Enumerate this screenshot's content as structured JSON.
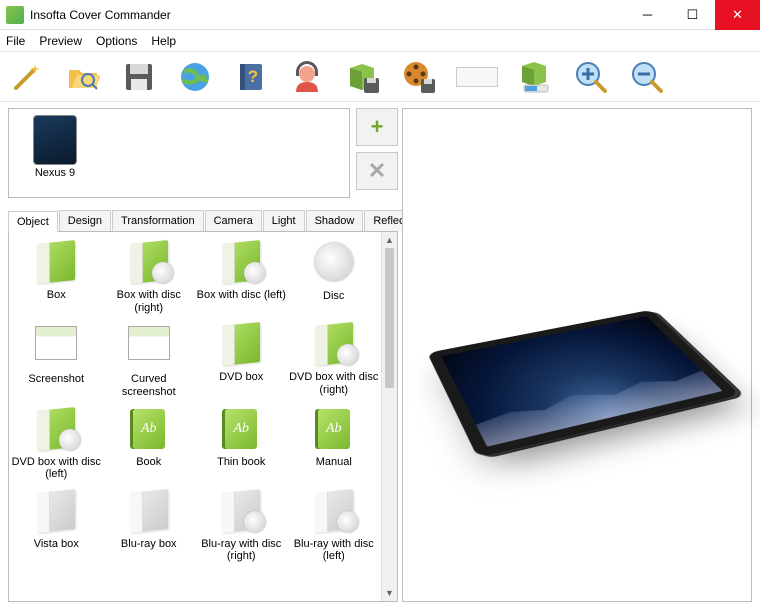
{
  "app": {
    "title": "Insofta Cover Commander"
  },
  "menu": [
    "File",
    "Preview",
    "Options",
    "Help"
  ],
  "toolbar_icons": [
    "wand",
    "open",
    "save",
    "globe",
    "help-book",
    "support",
    "save-pkg",
    "film-save",
    "input",
    "save-progress",
    "zoom-in",
    "zoom-out"
  ],
  "object_panel": {
    "selected_name": "Nexus 9",
    "add_label": "+",
    "del_label": "✕"
  },
  "tabs": [
    "Object",
    "Design",
    "Transformation",
    "Camera",
    "Light",
    "Shadow",
    "Reflection"
  ],
  "active_tab": 0,
  "gallery": [
    {
      "label": "Box",
      "kind": "box"
    },
    {
      "label": "Box with disc (right)",
      "kind": "box-disc"
    },
    {
      "label": "Box with disc (left)",
      "kind": "box-disc"
    },
    {
      "label": "Disc",
      "kind": "disc"
    },
    {
      "label": "Screenshot",
      "kind": "screenshot"
    },
    {
      "label": "Curved screenshot",
      "kind": "screenshot"
    },
    {
      "label": "DVD box",
      "kind": "box"
    },
    {
      "label": "DVD box with disc (right)",
      "kind": "box-disc"
    },
    {
      "label": "DVD box with disc (left)",
      "kind": "box-disc"
    },
    {
      "label": "Book",
      "kind": "book"
    },
    {
      "label": "Thin book",
      "kind": "book"
    },
    {
      "label": "Manual",
      "kind": "book"
    },
    {
      "label": "Vista box",
      "kind": "box-grey"
    },
    {
      "label": "Blu-ray box",
      "kind": "box-grey"
    },
    {
      "label": "Blu-ray with disc (right)",
      "kind": "box-grey-disc"
    },
    {
      "label": "Blu-ray with disc (left)",
      "kind": "box-grey-disc"
    }
  ]
}
